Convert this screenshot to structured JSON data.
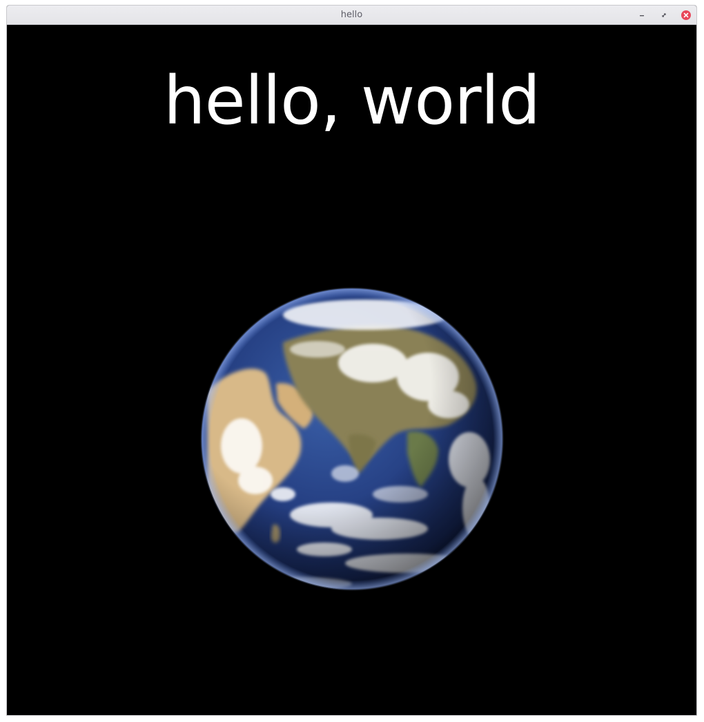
{
  "window": {
    "title": "hello",
    "controls": {
      "minimize_icon": "minimize-icon",
      "maximize_icon": "restore-icon",
      "close_icon": "close-icon"
    }
  },
  "content": {
    "headline": "hello, world",
    "image_subject": "earth-globe-from-space",
    "background_color": "#000000",
    "text_color": "#ffffff"
  },
  "colors": {
    "close_button": "#e8475a",
    "titlebar": "#e8e8ec"
  }
}
